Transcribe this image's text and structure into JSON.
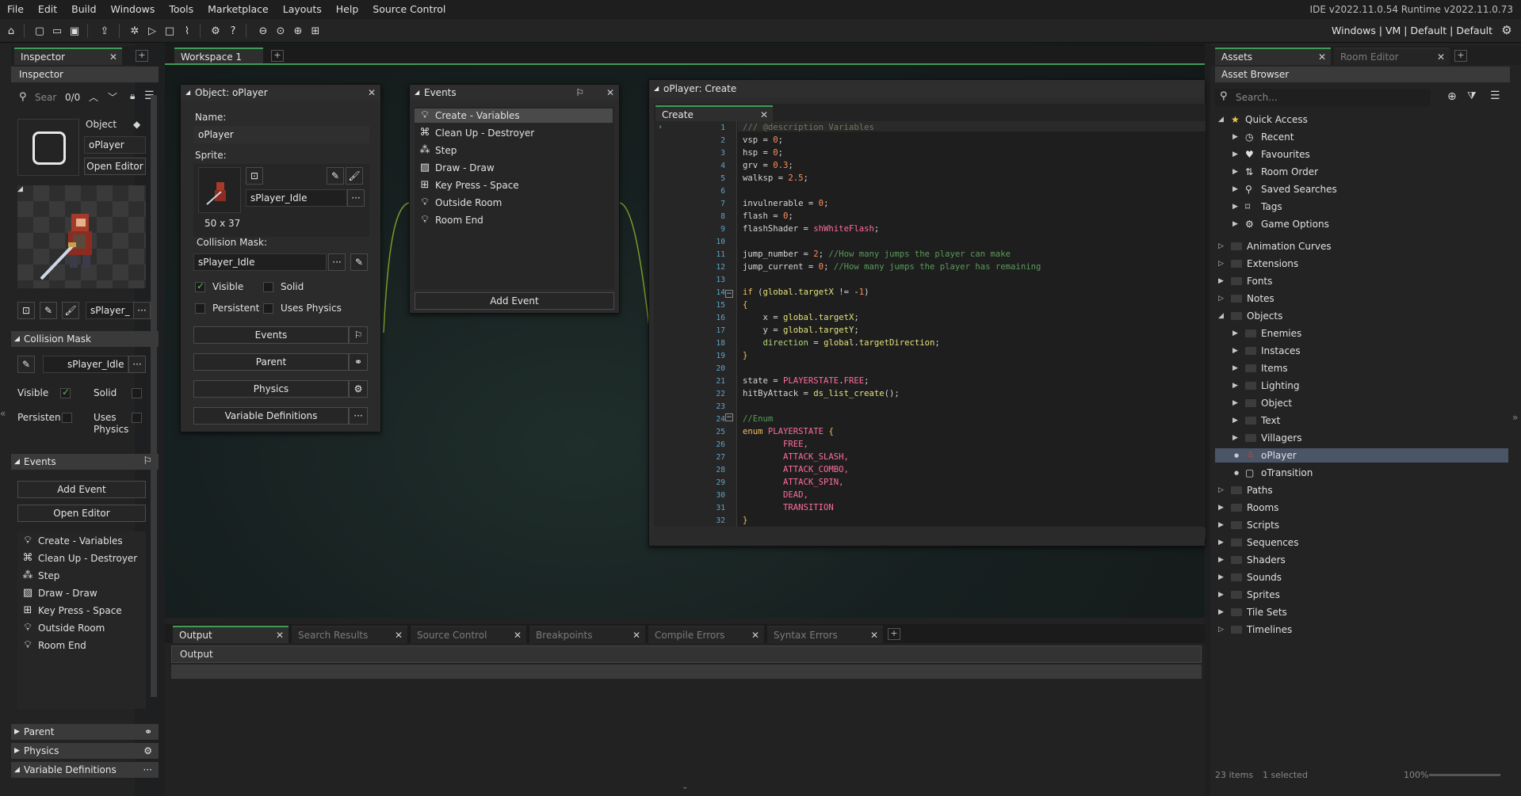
{
  "menu": [
    "File",
    "Edit",
    "Build",
    "Windows",
    "Tools",
    "Marketplace",
    "Layouts",
    "Help",
    "Source Control"
  ],
  "version": "IDE v2022.11.0.54  Runtime v2022.11.0.73",
  "target": "Windows | VM | Default | Default",
  "inspector": {
    "tab_label": "Inspector",
    "header": "Inspector",
    "search_placeholder": "Sear",
    "search_count": "0/0",
    "object_label": "Object",
    "object_name": "oPlayer",
    "open_editor": "Open Editor",
    "sprite_name": "sPlayer_",
    "collision_section": "Collision Mask",
    "collision_sprite": "sPlayer_Idle",
    "visible": "Visible",
    "solid": "Solid",
    "persistent": "Persisten",
    "uses_physics": "Uses Physics",
    "events_section": "Events",
    "add_event": "Add Event",
    "open_editor2": "Open Editor",
    "events": [
      "Create - Variables",
      "Clean Up - Destroyer",
      "Step",
      "Draw - Draw",
      "Key Press - Space",
      "Outside Room",
      "Room End"
    ],
    "parent": "Parent",
    "physics": "Physics",
    "variable_definitions": "Variable Definitions"
  },
  "workspace": {
    "tab_label": "Workspace 1"
  },
  "object_window": {
    "title": "Object: oPlayer",
    "name_label": "Name:",
    "name_value": "oPlayer",
    "sprite_label": "Sprite:",
    "sprite_value": "sPlayer_Idle",
    "sprite_size": "50 x 37",
    "collision_label": "Collision Mask:",
    "collision_value": "sPlayer_Idle",
    "visible": "Visible",
    "solid": "Solid",
    "persistent": "Persistent",
    "uses_physics": "Uses Physics",
    "events_btn": "Events",
    "parent_btn": "Parent",
    "physics_btn": "Physics",
    "vardef_btn": "Variable Definitions"
  },
  "events_window": {
    "title": "Events",
    "events": [
      "Create - Variables",
      "Clean Up - Destroyer",
      "Step",
      "Draw - Draw",
      "Key Press - Space",
      "Outside Room",
      "Room End"
    ],
    "add_event": "Add Event"
  },
  "code_window": {
    "title": "oPlayer: Create",
    "tab": "Create",
    "lines": [
      [
        {
          "t": "/// @description Variables",
          "c": "#6c7a5a"
        }
      ],
      [
        {
          "t": "vsp = ",
          "c": "#d6d6d6"
        },
        {
          "t": "0",
          "c": "#ff8c5a"
        },
        {
          "t": ";",
          "c": "#d6d6d6"
        }
      ],
      [
        {
          "t": "hsp = ",
          "c": "#d6d6d6"
        },
        {
          "t": "0",
          "c": "#ff8c5a"
        },
        {
          "t": ";",
          "c": "#d6d6d6"
        }
      ],
      [
        {
          "t": "grv = ",
          "c": "#d6d6d6"
        },
        {
          "t": "0.3",
          "c": "#ff8c5a"
        },
        {
          "t": ";",
          "c": "#d6d6d6"
        }
      ],
      [
        {
          "t": "walksp = ",
          "c": "#d6d6d6"
        },
        {
          "t": "2.5",
          "c": "#ff8c5a"
        },
        {
          "t": ";",
          "c": "#d6d6d6"
        }
      ],
      [],
      [
        {
          "t": "invulnerable = ",
          "c": "#d6d6d6"
        },
        {
          "t": "0",
          "c": "#ff8c5a"
        },
        {
          "t": ";",
          "c": "#d6d6d6"
        }
      ],
      [
        {
          "t": "flash = ",
          "c": "#d6d6d6"
        },
        {
          "t": "0",
          "c": "#ff8c5a"
        },
        {
          "t": ";",
          "c": "#d6d6d6"
        }
      ],
      [
        {
          "t": "flashShader = ",
          "c": "#d6d6d6"
        },
        {
          "t": "shWhiteFlash",
          "c": "#ff6d9c"
        },
        {
          "t": ";",
          "c": "#d6d6d6"
        }
      ],
      [],
      [
        {
          "t": "jump_number = ",
          "c": "#d6d6d6"
        },
        {
          "t": "2",
          "c": "#ff8c5a"
        },
        {
          "t": "; ",
          "c": "#d6d6d6"
        },
        {
          "t": "//How many jumps the player can make",
          "c": "#5b9a5b"
        }
      ],
      [
        {
          "t": "jump_current = ",
          "c": "#d6d6d6"
        },
        {
          "t": "0",
          "c": "#ff8c5a"
        },
        {
          "t": "; ",
          "c": "#d6d6d6"
        },
        {
          "t": "//How many jumps the player has remaining",
          "c": "#5b9a5b"
        }
      ],
      [],
      [
        {
          "t": "if ",
          "c": "#f0c05a"
        },
        {
          "t": "(",
          "c": "#d6d6d6"
        },
        {
          "t": "global",
          "c": "#e4e27a"
        },
        {
          "t": ".",
          "c": "#d6d6d6"
        },
        {
          "t": "targetX",
          "c": "#e4e27a"
        },
        {
          "t": " != -",
          "c": "#d6d6d6"
        },
        {
          "t": "1",
          "c": "#ff8c5a"
        },
        {
          "t": ")",
          "c": "#d6d6d6"
        }
      ],
      [
        {
          "t": "{",
          "c": "#f0c05a"
        }
      ],
      [
        {
          "t": "    x = ",
          "c": "#d6d6d6"
        },
        {
          "t": "global",
          "c": "#e4e27a"
        },
        {
          "t": ".",
          "c": "#d6d6d6"
        },
        {
          "t": "targetX",
          "c": "#e4e27a"
        },
        {
          "t": ";",
          "c": "#d6d6d6"
        }
      ],
      [
        {
          "t": "    y = ",
          "c": "#d6d6d6"
        },
        {
          "t": "global",
          "c": "#e4e27a"
        },
        {
          "t": ".",
          "c": "#d6d6d6"
        },
        {
          "t": "targetY",
          "c": "#e4e27a"
        },
        {
          "t": ";",
          "c": "#d6d6d6"
        }
      ],
      [
        {
          "t": "    direction",
          "c": "#b4d77a"
        },
        {
          "t": " = ",
          "c": "#d6d6d6"
        },
        {
          "t": "global",
          "c": "#e4e27a"
        },
        {
          "t": ".",
          "c": "#d6d6d6"
        },
        {
          "t": "targetDirection",
          "c": "#e4e27a"
        },
        {
          "t": ";",
          "c": "#d6d6d6"
        }
      ],
      [
        {
          "t": "}",
          "c": "#f0c05a"
        }
      ],
      [],
      [
        {
          "t": "state = ",
          "c": "#d6d6d6"
        },
        {
          "t": "PLAYERSTATE",
          "c": "#ff6d9c"
        },
        {
          "t": ".",
          "c": "#d6d6d6"
        },
        {
          "t": "FREE",
          "c": "#ff6d9c"
        },
        {
          "t": ";",
          "c": "#d6d6d6"
        }
      ],
      [
        {
          "t": "hitByAttack = ",
          "c": "#d6d6d6"
        },
        {
          "t": "ds_list_create",
          "c": "#e4e27a"
        },
        {
          "t": "();",
          "c": "#d6d6d6"
        }
      ],
      [],
      [
        {
          "t": "//Enum",
          "c": "#5b9a5b"
        }
      ],
      [
        {
          "t": "enum ",
          "c": "#f0c05a"
        },
        {
          "t": "PLAYERSTATE",
          "c": "#ff6d9c"
        },
        {
          "t": " {",
          "c": "#f0c05a"
        }
      ],
      [
        {
          "t": "        FREE,",
          "c": "#ff6d9c"
        }
      ],
      [
        {
          "t": "        ATTACK_SLASH,",
          "c": "#ff6d9c"
        }
      ],
      [
        {
          "t": "        ATTACK_COMBO,",
          "c": "#ff6d9c"
        }
      ],
      [
        {
          "t": "        ATTACK_SPIN,",
          "c": "#ff6d9c"
        }
      ],
      [
        {
          "t": "        DEAD,",
          "c": "#ff6d9c"
        }
      ],
      [
        {
          "t": "        TRANSITION",
          "c": "#ff6d9c"
        }
      ],
      [
        {
          "t": "}",
          "c": "#f0c05a"
        }
      ]
    ]
  },
  "output": {
    "tabs": [
      "Output",
      "Search Results",
      "Source Control",
      "Breakpoints",
      "Compile Errors",
      "Syntax Errors"
    ],
    "header": "Output"
  },
  "assets": {
    "tab_assets": "Assets",
    "tab_room": "Room Editor",
    "header": "Asset Browser",
    "search_placeholder": "Search...",
    "quick_access": "Quick Access",
    "quick_items": [
      "Recent",
      "Favourites",
      "Room Order",
      "Saved Searches",
      "Tags",
      "Game Options"
    ],
    "groups": [
      "Animation Curves",
      "Extensions",
      "Fonts",
      "Notes"
    ],
    "objects": "Objects",
    "object_children": [
      "Enemies",
      "Instaces",
      "Items",
      "Lighting",
      "Object",
      "Text",
      "Villagers"
    ],
    "object_leaves": [
      "oPlayer",
      "oTransition"
    ],
    "groups2": [
      "Paths",
      "Rooms",
      "Scripts",
      "Sequences",
      "Shaders",
      "Sounds",
      "Sprites",
      "Tile Sets",
      "Timelines"
    ],
    "status_items": "23 items",
    "status_selected": "1 selected",
    "zoom": "100%"
  }
}
